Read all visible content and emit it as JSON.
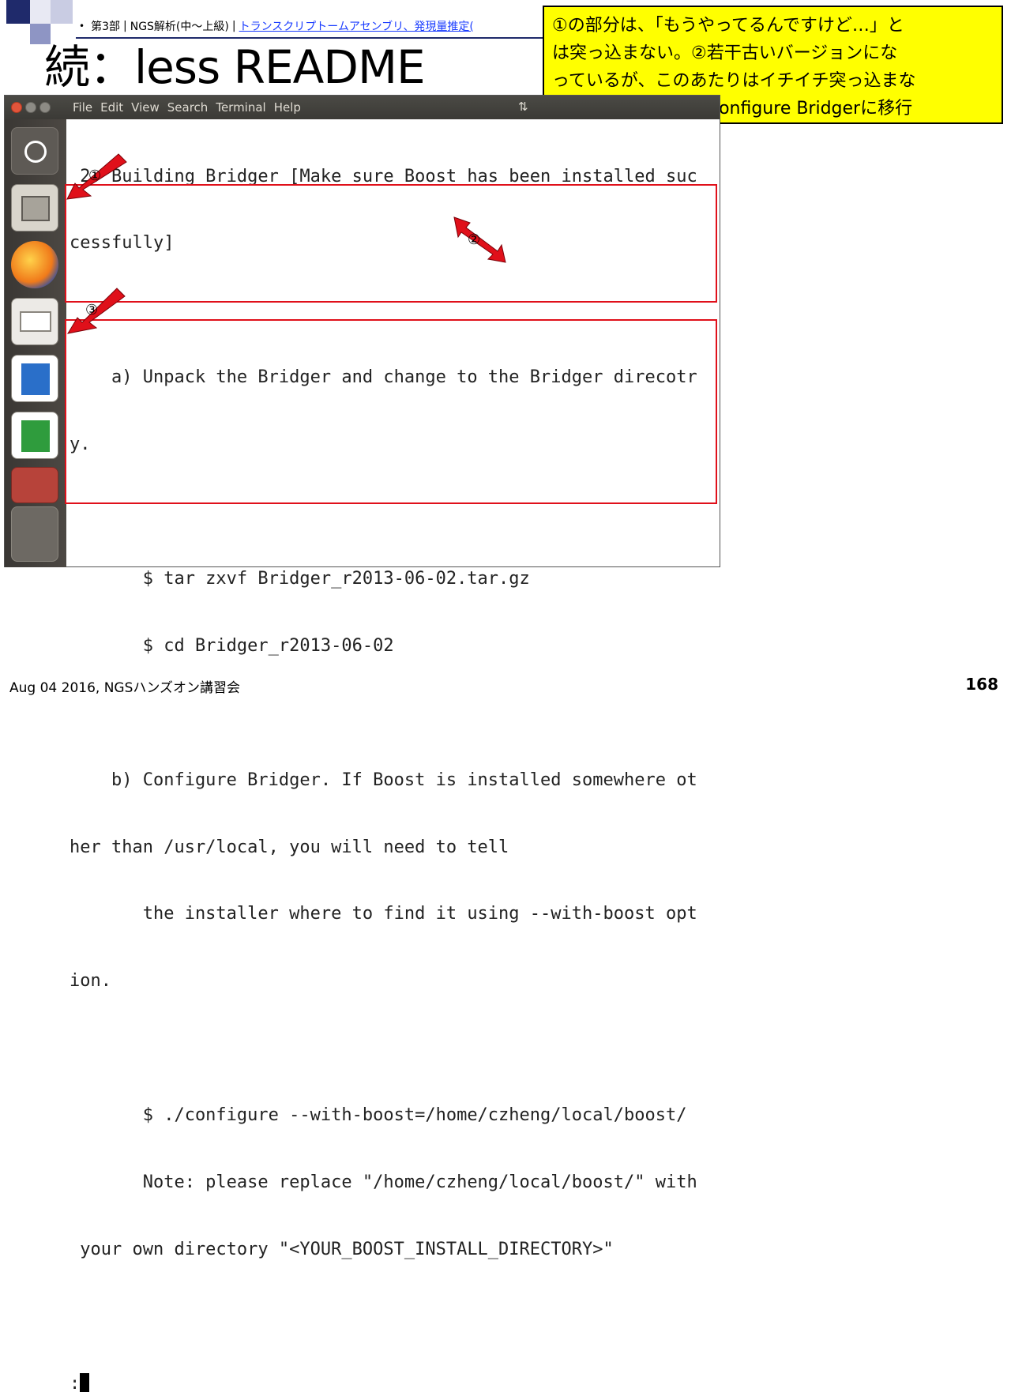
{
  "slide": {
    "breadcrumb": {
      "bullet": "•",
      "part": "第3部",
      "sep1": "|",
      "section": "NGS解析(中～上級)",
      "sep2": "|",
      "link": "トランスクリプトームアセンブリ、発現量推定("
    },
    "title": "続：less README",
    "callout": "①の部分は、「もうやってるんですけど…」と\nは突っ込まない。②若干古いバージョンにな\nっているが、このあたりはイチイチ突っ込まな\nいのもお約束。③のConfigure Bridgerに移行",
    "markers": [
      "①",
      "②",
      "③"
    ],
    "footer_left": "Aug 04 2016, NGSハンズオン講習会",
    "page_number": "168"
  },
  "window": {
    "menu": [
      "File",
      "Edit",
      "View",
      "Search",
      "Terminal",
      "Help"
    ],
    "tray_icon": "network-arrows-icon",
    "launcher": [
      "ubuntu-dash-icon",
      "files-icon",
      "firefox-icon",
      "mail-icon",
      "writer-icon",
      "calc-icon",
      "impress-icon",
      "workspace-switcher-icon"
    ]
  },
  "terminal": {
    "lines": [
      " 2. Building Bridger [Make sure Boost has been installed suc",
      "cessfully]",
      "",
      "    a) Unpack the Bridger and change to the Bridger direcotr",
      "y.",
      "",
      "       $ tar zxvf Bridger_r2013-06-02.tar.gz",
      "       $ cd Bridger_r2013-06-02",
      "",
      "    b) Configure Bridger. If Boost is installed somewhere ot",
      "her than /usr/local, you will need to tell",
      "       the installer where to find it using --with-boost opt",
      "ion.",
      "",
      "       $ ./configure --with-boost=/home/czheng/local/boost/",
      "       Note: please replace \"/home/czheng/local/boost/\" with",
      " your own directory \"<YOUR_BOOST_INSTALL_DIRECTORY>\"",
      "",
      ":"
    ]
  }
}
